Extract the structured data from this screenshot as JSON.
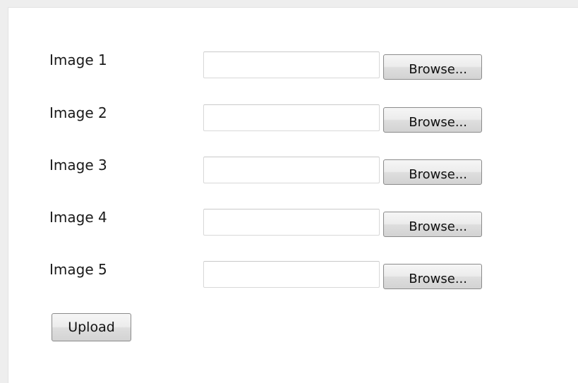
{
  "form": {
    "rows": [
      {
        "label": "Image 1",
        "value": "",
        "browse_label": "Browse..."
      },
      {
        "label": "Image 2",
        "value": "",
        "browse_label": "Browse..."
      },
      {
        "label": "Image 3",
        "value": "",
        "browse_label": "Browse..."
      },
      {
        "label": "Image 4",
        "value": "",
        "browse_label": "Browse..."
      },
      {
        "label": "Image 5",
        "value": "",
        "browse_label": "Browse..."
      }
    ],
    "upload_label": "Upload"
  }
}
